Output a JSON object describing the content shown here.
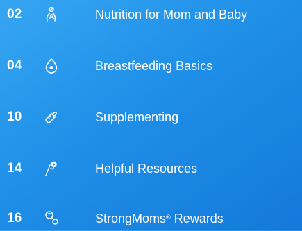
{
  "toc": {
    "items": [
      {
        "page": "02",
        "title": "Nutrition for Mom and Baby",
        "icon": "mom-holding-baby-icon"
      },
      {
        "page": "04",
        "title": "Breastfeeding Basics",
        "icon": "milk-drop-icon"
      },
      {
        "page": "10",
        "title": "Supplementing",
        "icon": "baby-bottle-icon"
      },
      {
        "page": "14",
        "title": "Helpful Resources",
        "icon": "stethoscope-icon"
      },
      {
        "page": "16",
        "title_main": "StrongMoms",
        "title_mark": "®",
        "title_rest": " Rewards",
        "icon": "pacifier-icon"
      }
    ]
  }
}
